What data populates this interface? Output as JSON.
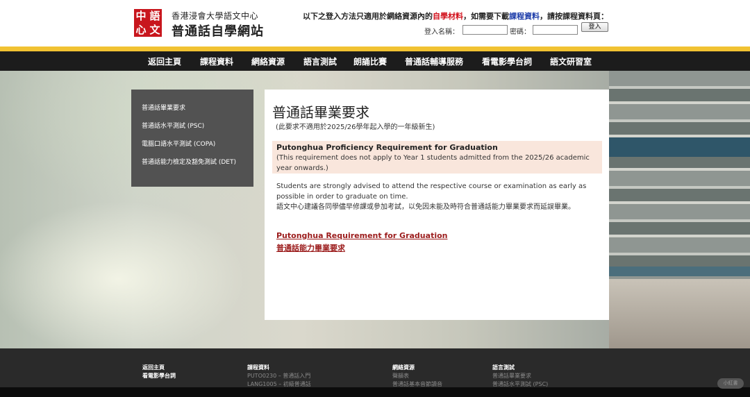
{
  "header": {
    "logo_chars": [
      "中",
      "語",
      "心",
      "文"
    ],
    "site_subtitle": "香港浸會大學語文中心",
    "site_title": "普通話自學網站",
    "login_note_1": "以下之登入方法只適用於網絡資源內的",
    "login_note_red": "自學材料",
    "login_note_2": "，如需要下載",
    "login_note_blue": "課程資料",
    "login_note_3": "，請按課程資料頁：",
    "username_label": "登入名稱：",
    "username_value": "",
    "password_label": "密碼：",
    "password_value": "",
    "login_button": "登入"
  },
  "nav": {
    "items": [
      "返回主頁",
      "課程資料",
      "網絡資源",
      "語言測試",
      "朗誦比賽",
      "普通話輔導服務",
      "看電影學台詞",
      "語文研習室"
    ]
  },
  "sidebar": {
    "items": [
      "普通話畢業要求",
      "普通話水平測試 (PSC)",
      "電腦口語水平測試 (COPA)",
      "普通話能力檢定及豁免測試 (DET)"
    ]
  },
  "main": {
    "title": "普通話畢業要求",
    "note": "(此要求不適用於2025/26學年起入學的一年級新生)",
    "notice_title": "Putonghua Proficiency Requirement for Graduation",
    "notice_text": "(This requirement does not apply to Year 1 students admitted from the 2025/26 academic year onwards.)",
    "advice_en": "Students are strongly advised to attend the respective course or examination as early as possible in order to graduate on time.",
    "advice_zh": "語文中心建議各同學儘早修課或參加考試，以免因未能及時符合普通話能力畢業要求而延誤畢業。",
    "link_en": "Putonghua Requirement for Graduation",
    "link_zh": "普通話能力畢業要求"
  },
  "footer": {
    "col1": {
      "head": "返回主頁",
      "extra": "看電影學台詞"
    },
    "col2": {
      "head": "課程資料",
      "links": [
        "PUTO0230 – 普通話入門",
        "LANG1005 – 初級普通話"
      ]
    },
    "col3": {
      "head": "網絡資源",
      "links": [
        "聲韻表",
        "普通話基本音節讀音"
      ]
    },
    "col4": {
      "head": "語言測試",
      "links": [
        "普通話畢業要求",
        "普通話水平測試 (PSC)"
      ]
    },
    "badge": "小紅書"
  },
  "colors": {
    "gold": "#f1c232",
    "nav_bg": "#1c1c1c",
    "sidebar_bg": "#525252",
    "notice_bg": "#f9e6dc",
    "link": "#9b1b1b",
    "logo_red": "#c8161d"
  }
}
